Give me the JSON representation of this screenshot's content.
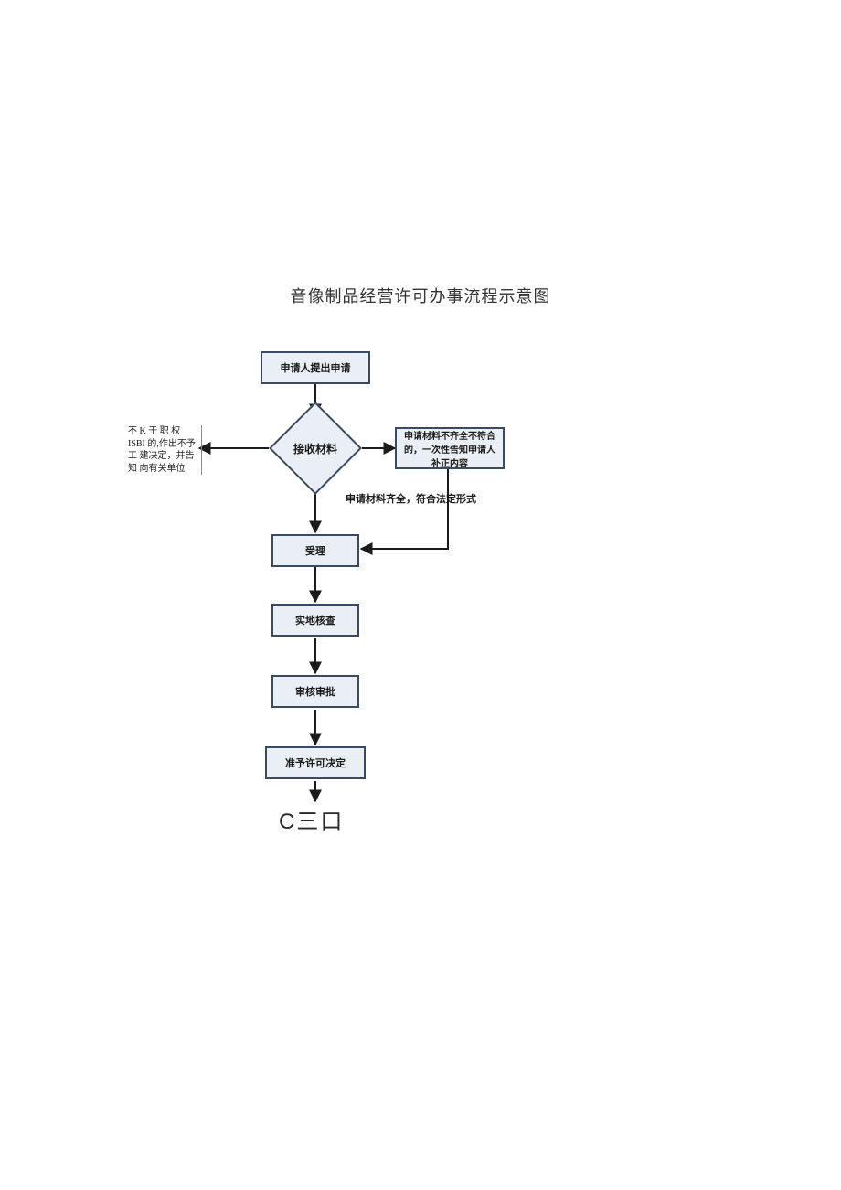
{
  "title": "音像制品经营许可办事流程示意图",
  "flow": {
    "step1": "申请人提出申请",
    "decision": "接收材料",
    "left_note": "不 K 于 职 权 ISBI 的,作出不予工 建决定，并告知 向有关单位",
    "right_box": "申请材料不齐全不符合的，一次性告知申请人补正内容",
    "branch_ok": "申请材料齐全，符合法定形式",
    "step2": "受理",
    "step3": "实地核查",
    "step4": "审核审批",
    "step5": "准予许可决定",
    "terminal": "C三口"
  }
}
